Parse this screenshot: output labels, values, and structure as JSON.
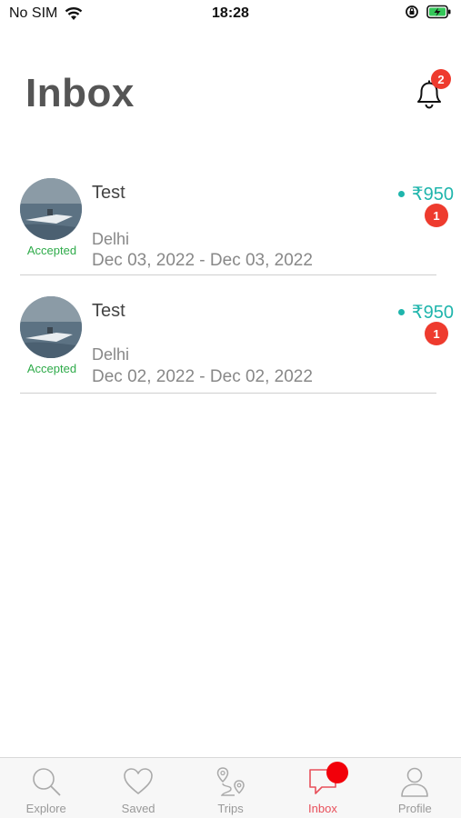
{
  "status_bar": {
    "carrier": "No SIM",
    "time": "18:28"
  },
  "header": {
    "title": "Inbox",
    "notification_count": "2"
  },
  "conversations": [
    {
      "name": "Test",
      "price": "₹950",
      "unread": "1",
      "status": "Accepted",
      "city": "Delhi",
      "dates": "Dec 03, 2022 - Dec 03, 2022"
    },
    {
      "name": "Test",
      "price": "₹950",
      "unread": "1",
      "status": "Accepted",
      "city": "Delhi",
      "dates": "Dec 02, 2022 - Dec 02, 2022"
    }
  ],
  "tabs": [
    {
      "label": "Explore",
      "icon": "search-icon"
    },
    {
      "label": "Saved",
      "icon": "heart-icon"
    },
    {
      "label": "Trips",
      "icon": "route-pin-icon"
    },
    {
      "label": "Inbox",
      "icon": "chat-bubble-icon",
      "active": true
    },
    {
      "label": "Profile",
      "icon": "person-icon"
    }
  ],
  "colors": {
    "accent": "#e8505b",
    "price": "#1fb5ac",
    "accepted": "#2fab4a",
    "badge": "#ee3b2e"
  }
}
